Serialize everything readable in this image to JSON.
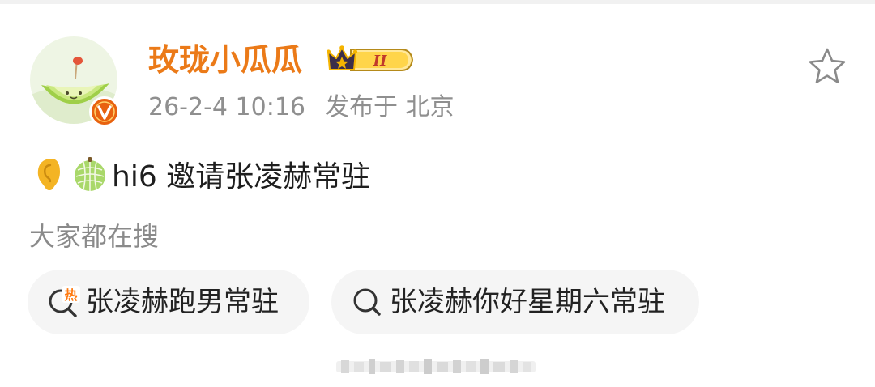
{
  "post": {
    "author": {
      "name": "玫珑小瓜瓜",
      "vip_level": "II",
      "verified": true
    },
    "date": "26-2-4 10:16",
    "location": "发布于 北京",
    "text": "hi6 邀请张凌赫常驻",
    "leading_emojis": [
      "ear-emoji",
      "melon-emoji"
    ]
  },
  "trending": {
    "label": "大家都在搜",
    "items": [
      {
        "icon": "hot-search-icon",
        "label": "张凌赫跑男常驻"
      },
      {
        "icon": "search-icon",
        "label": "张凌赫你好星期六常驻"
      }
    ]
  },
  "colors": {
    "username": "#eb7a18",
    "meta_text": "#8f8f8f",
    "chip_background": "#f5f5f5",
    "verified_badge": "#e8620f",
    "vip_gold": "#f5b400"
  }
}
